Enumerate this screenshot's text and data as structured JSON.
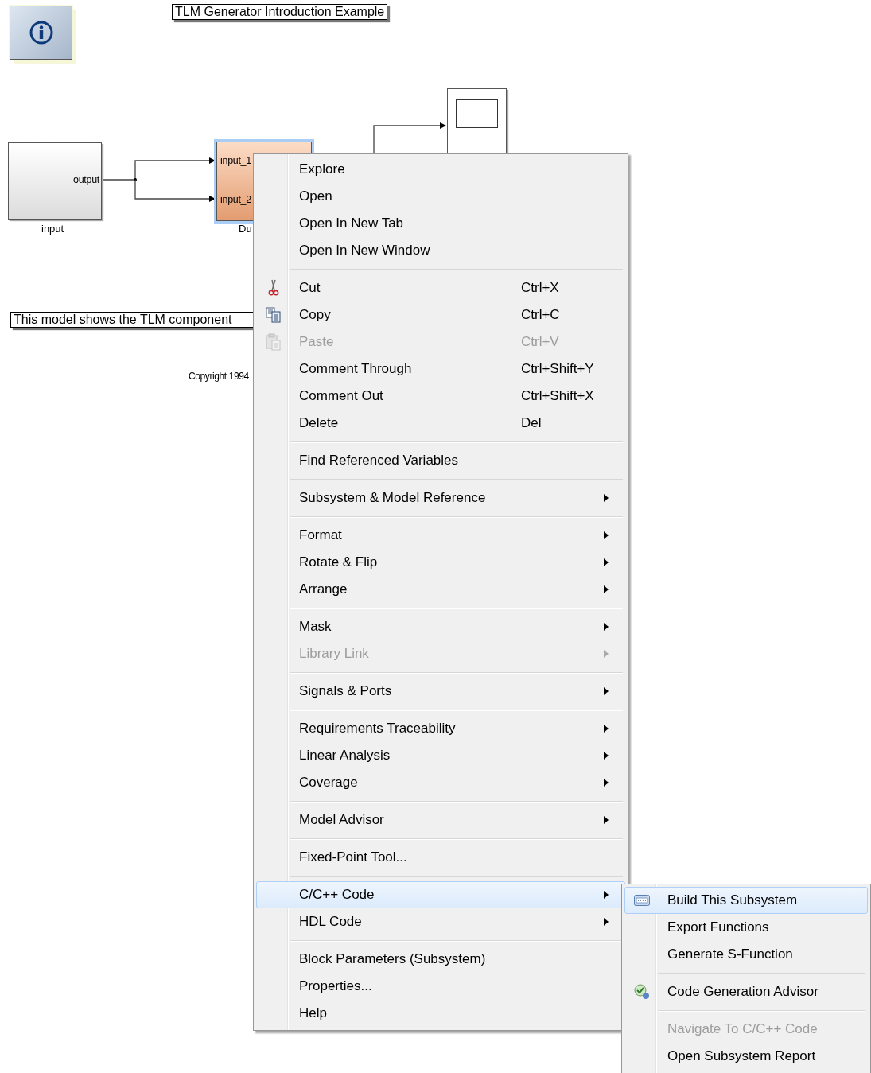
{
  "diagram": {
    "title_annotation": "TLM Generator Introduction Example",
    "description_annotation": "This model shows the TLM component",
    "copyright": "Copyright 1994",
    "blocks": [
      {
        "kind": "source",
        "name": "input",
        "port_labels": [
          "output"
        ],
        "selected": false
      },
      {
        "kind": "subsystem",
        "name": "Du",
        "port_labels": [
          "input_1",
          "input_2"
        ],
        "selected": true
      },
      {
        "kind": "scope",
        "selected": false
      }
    ]
  },
  "context_menu": {
    "groups": [
      [
        {
          "label": "Explore",
          "selected": false,
          "disabled": false,
          "has_submenu": false
        },
        {
          "label": "Open",
          "selected": false,
          "disabled": false,
          "has_submenu": false
        },
        {
          "label": "Open In New Tab",
          "selected": false,
          "disabled": false,
          "has_submenu": false
        },
        {
          "label": "Open In New Window",
          "selected": false,
          "disabled": false,
          "has_submenu": false
        }
      ],
      [
        {
          "label": "Cut",
          "shortcut": "Ctrl+X",
          "kind": "cut",
          "selected": false,
          "disabled": false,
          "has_submenu": false
        },
        {
          "label": "Copy",
          "shortcut": "Ctrl+C",
          "kind": "copy",
          "selected": false,
          "disabled": false,
          "has_submenu": false
        },
        {
          "label": "Paste",
          "shortcut": "Ctrl+V",
          "kind": "paste",
          "selected": false,
          "disabled": true,
          "has_submenu": false
        },
        {
          "label": "Comment Through",
          "shortcut": "Ctrl+Shift+Y",
          "selected": false,
          "disabled": false,
          "has_submenu": false
        },
        {
          "label": "Comment Out",
          "shortcut": "Ctrl+Shift+X",
          "selected": false,
          "disabled": false,
          "has_submenu": false
        },
        {
          "label": "Delete",
          "shortcut": "Del",
          "selected": false,
          "disabled": false,
          "has_submenu": false
        }
      ],
      [
        {
          "label": "Find Referenced Variables",
          "selected": false,
          "disabled": false,
          "has_submenu": false
        }
      ],
      [
        {
          "label": "Subsystem & Model Reference",
          "selected": false,
          "disabled": false,
          "has_submenu": true
        }
      ],
      [
        {
          "label": "Format",
          "selected": false,
          "disabled": false,
          "has_submenu": true
        },
        {
          "label": "Rotate & Flip",
          "selected": false,
          "disabled": false,
          "has_submenu": true
        },
        {
          "label": "Arrange",
          "selected": false,
          "disabled": false,
          "has_submenu": true
        }
      ],
      [
        {
          "label": "Mask",
          "selected": false,
          "disabled": false,
          "has_submenu": true
        },
        {
          "label": "Library Link",
          "selected": false,
          "disabled": true,
          "has_submenu": true
        }
      ],
      [
        {
          "label": "Signals & Ports",
          "selected": false,
          "disabled": false,
          "has_submenu": true
        }
      ],
      [
        {
          "label": "Requirements Traceability",
          "selected": false,
          "disabled": false,
          "has_submenu": true
        },
        {
          "label": "Linear Analysis",
          "selected": false,
          "disabled": false,
          "has_submenu": true
        },
        {
          "label": "Coverage",
          "selected": false,
          "disabled": false,
          "has_submenu": true
        }
      ],
      [
        {
          "label": "Model Advisor",
          "selected": false,
          "disabled": false,
          "has_submenu": true
        }
      ],
      [
        {
          "label": "Fixed-Point Tool...",
          "selected": false,
          "disabled": false,
          "has_submenu": false
        }
      ],
      [
        {
          "label": "C/C++ Code",
          "selected": true,
          "disabled": false,
          "has_submenu": true
        },
        {
          "label": "HDL Code",
          "selected": false,
          "disabled": false,
          "has_submenu": true
        }
      ],
      [
        {
          "label": "Block Parameters (Subsystem)",
          "selected": false,
          "disabled": false,
          "has_submenu": false
        },
        {
          "label": "Properties...",
          "selected": false,
          "disabled": false,
          "has_submenu": false
        },
        {
          "label": "Help",
          "selected": false,
          "disabled": false,
          "has_submenu": false
        }
      ]
    ]
  },
  "submenu": {
    "groups": [
      [
        {
          "label": "Build This Subsystem",
          "kind": "build",
          "selected": true,
          "disabled": false
        },
        {
          "label": "Export Functions",
          "selected": false,
          "disabled": false
        },
        {
          "label": "Generate S-Function",
          "selected": false,
          "disabled": false
        }
      ],
      [
        {
          "label": "Code Generation Advisor",
          "kind": "advisor",
          "selected": false,
          "disabled": false
        }
      ],
      [
        {
          "label": "Navigate To C/C++ Code",
          "selected": false,
          "disabled": true
        },
        {
          "label": "Open Subsystem Report",
          "selected": false,
          "disabled": false
        }
      ]
    ]
  }
}
